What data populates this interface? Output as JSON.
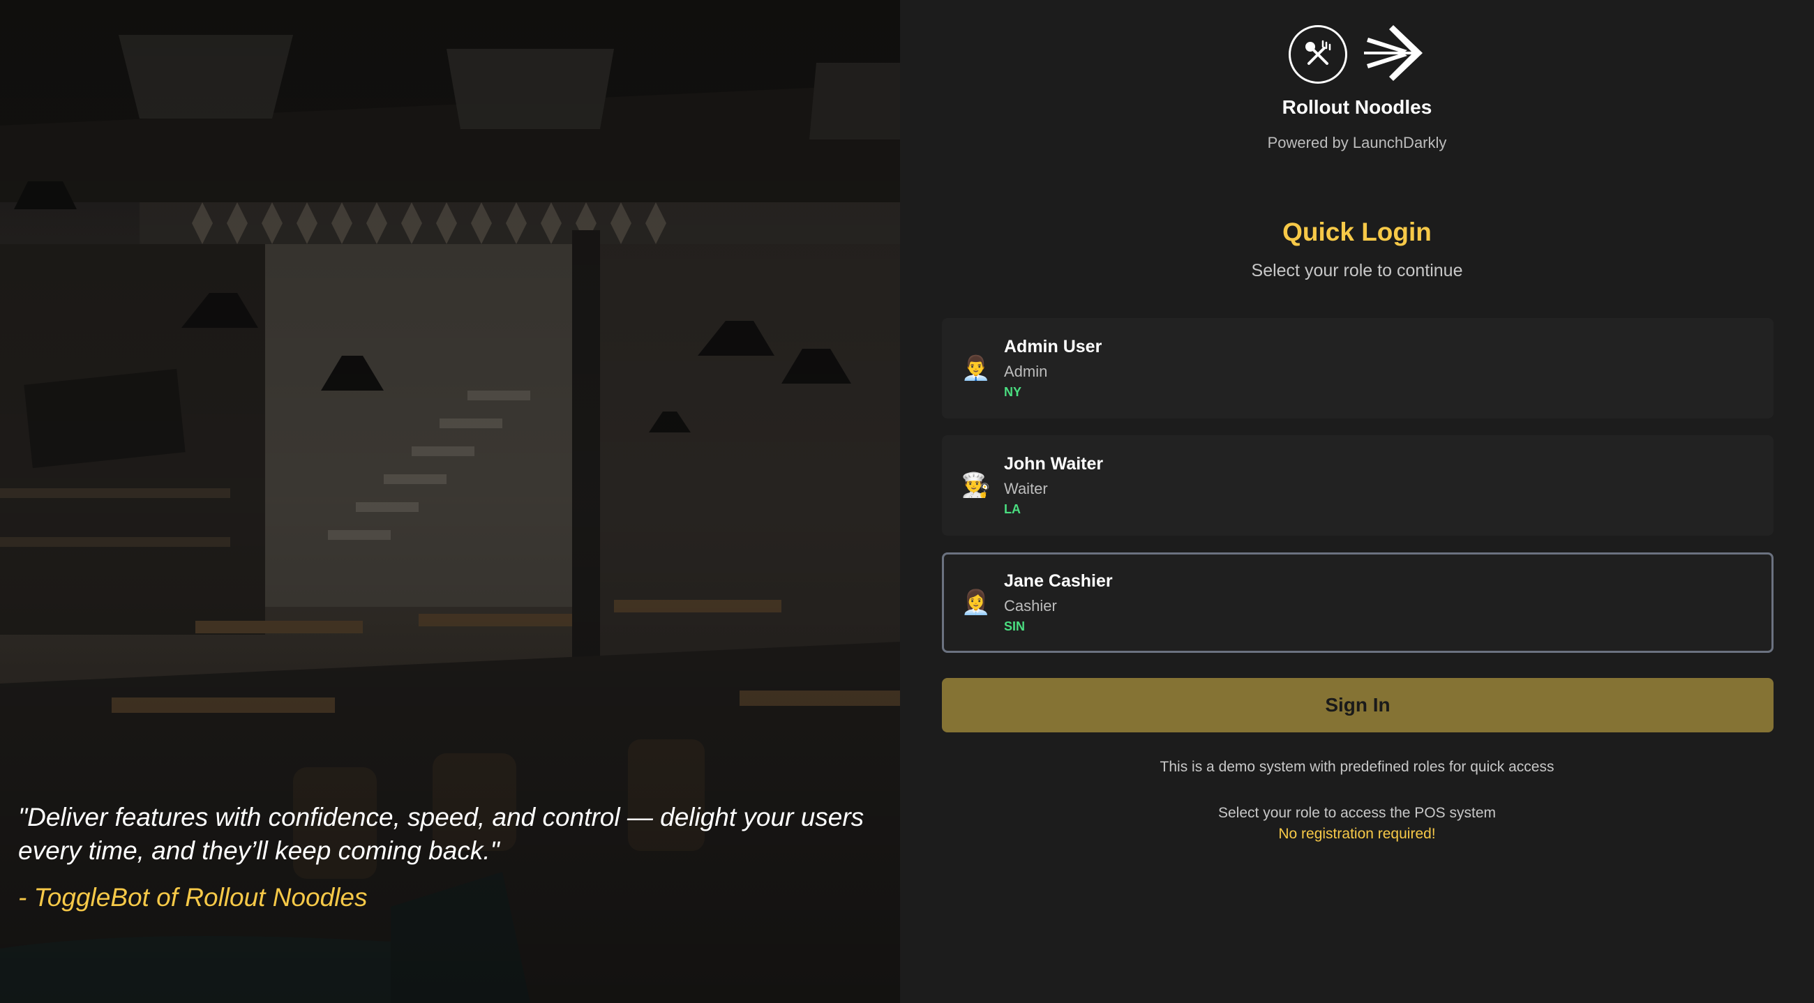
{
  "colors": {
    "accent": "#f7c948",
    "location": "#4ade80",
    "signin_button": "#857334",
    "background": "#1c1c1c",
    "card": "#222222"
  },
  "hero": {
    "image": "restaurant-interior-photo",
    "quote": "\"Deliver features with confidence, speed, and control — delight your users every time, and they’ll keep coming back.\"",
    "author": "- ToggleBot of Rollout Noodles"
  },
  "brand": {
    "logo_icons": [
      "fork-knife-icon",
      "launchdarkly-arrow-icon"
    ],
    "name": "Rollout Noodles",
    "powered_by": "Powered by LaunchDarkly"
  },
  "login": {
    "title": "Quick Login",
    "subtitle": "Select your role to continue",
    "roles": [
      {
        "emoji": "👨‍💼",
        "name": "Admin User",
        "role": "Admin",
        "location": "NY",
        "selected": false
      },
      {
        "emoji": "👨‍🍳",
        "name": "John Waiter",
        "role": "Waiter",
        "location": "LA",
        "selected": false
      },
      {
        "emoji": "👩‍💼",
        "name": "Jane Cashier",
        "role": "Cashier",
        "location": "SIN",
        "selected": true
      }
    ],
    "signin_label": "Sign In",
    "demo_note": "This is a demo system with predefined roles for quick access",
    "access_note": "Select your role to access the POS system",
    "no_registration": "No registration required!"
  }
}
